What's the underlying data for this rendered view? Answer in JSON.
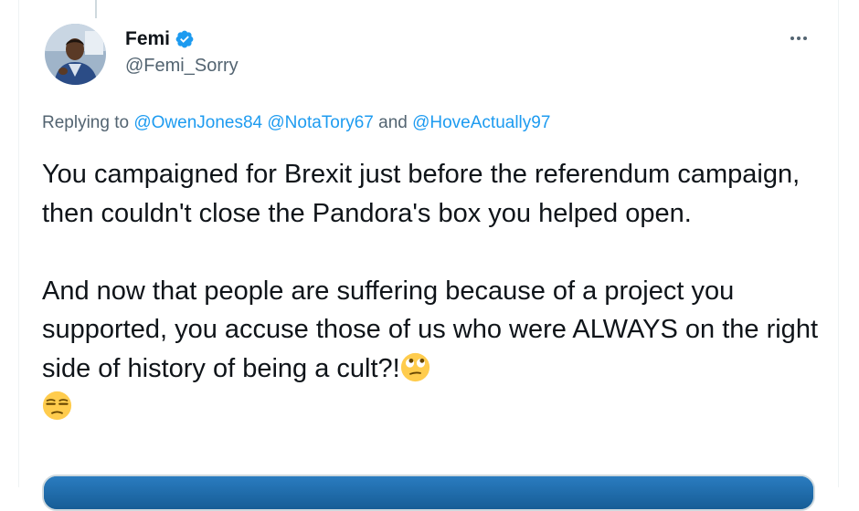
{
  "tweet": {
    "author": {
      "display_name": "Femi",
      "handle": "@Femi_Sorry",
      "verified": true,
      "avatar_icon": "avatar-photo"
    },
    "reply": {
      "prefix": "Replying to",
      "mentions": [
        "@OwenJones84",
        "@NotaTory67"
      ],
      "conjunction": "and",
      "last_mention": "@HoveActually97"
    },
    "text": {
      "paragraph_1": "You campaigned for Brexit just before the referendum campaign, then couldn't close the Pandora's box you helped open.",
      "paragraph_2": "And now that people are suffering because of a project you supported, you accuse those of us who were ALWAYS on the right side of history of being a cult?!",
      "emojis": [
        "face-with-rolling-eyes-emoji",
        "unamused-face-emoji"
      ]
    },
    "more_icon": "more-horizontal-icon",
    "media": "media-preview"
  },
  "colors": {
    "link": "#1d9bf0",
    "text": "#0f1419",
    "secondary": "#536471",
    "verified": "#1d9bf0"
  }
}
